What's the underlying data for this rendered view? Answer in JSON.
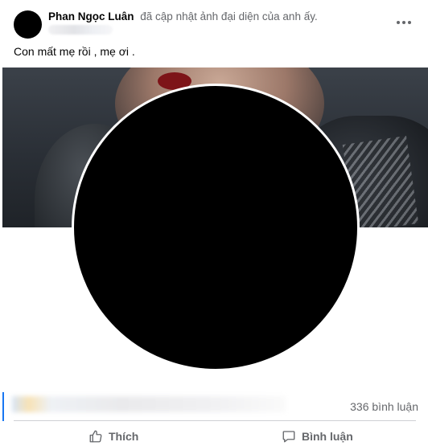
{
  "post": {
    "author": "Phan Ngọc Luân",
    "action_text": "đã cập nhật ảnh đại diện của anh ấy.",
    "caption": "Con mất mẹ rồi , mẹ ơi ."
  },
  "stats": {
    "comment_count": "336 bình luận"
  },
  "actions": {
    "like_label": "Thích",
    "comment_label": "Bình luận"
  },
  "icons": {
    "more": "more-horizontal-icon",
    "like": "thumbs-up-icon",
    "comment": "comment-bubble-icon"
  },
  "colors": {
    "accent": "#1877f2",
    "secondary_text": "#65676b",
    "profile_ring": "#ffffff"
  }
}
